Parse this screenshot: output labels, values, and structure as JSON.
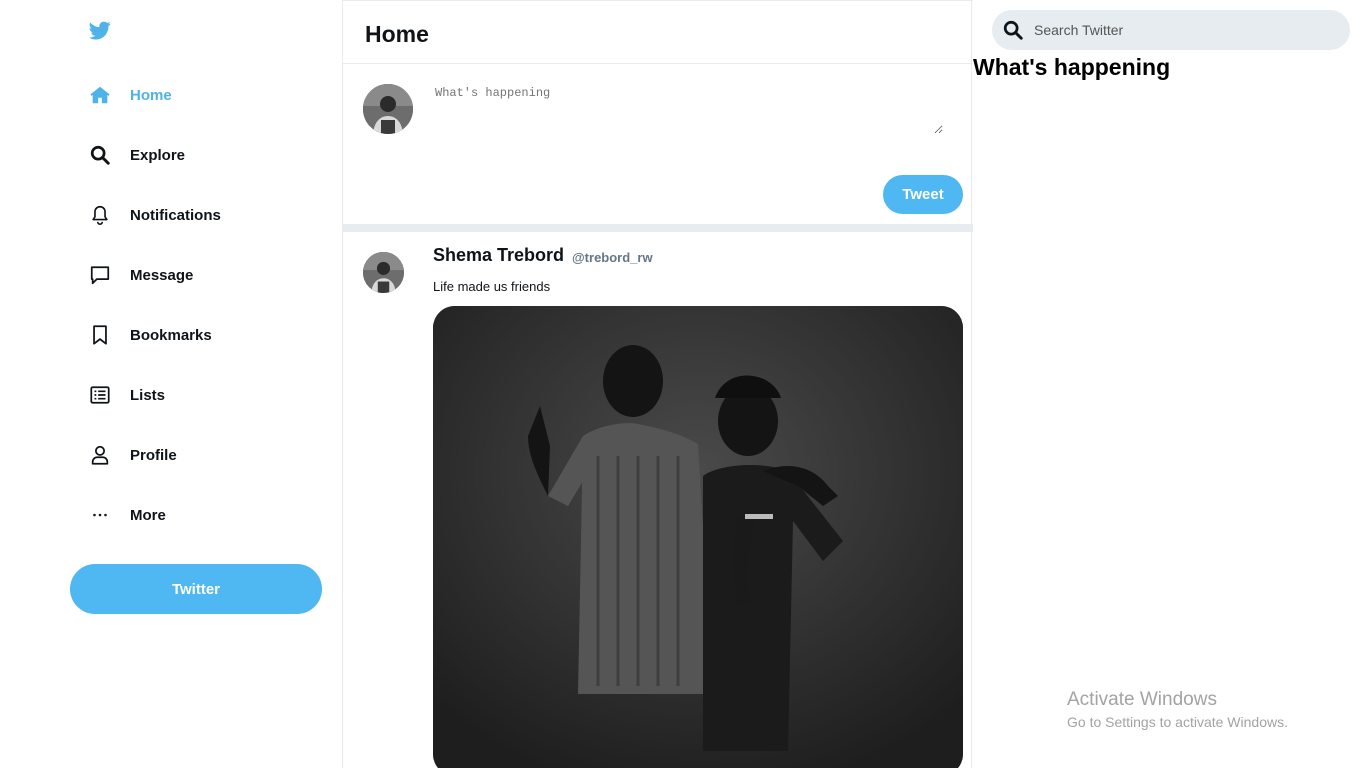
{
  "sidebar": {
    "logo_icon": "twitter-bird-icon",
    "items": [
      {
        "label": "Home",
        "icon": "home-icon",
        "active": true
      },
      {
        "label": "Explore",
        "icon": "search-icon"
      },
      {
        "label": "Notifications",
        "icon": "bell-icon"
      },
      {
        "label": "Message",
        "icon": "message-icon"
      },
      {
        "label": "Bookmarks",
        "icon": "bookmark-icon"
      },
      {
        "label": "Lists",
        "icon": "list-icon"
      },
      {
        "label": "Profile",
        "icon": "profile-icon"
      },
      {
        "label": "More",
        "icon": "more-icon"
      }
    ],
    "tweet_button_label": "Twitter"
  },
  "main": {
    "title": "Home",
    "composer": {
      "placeholder": "What's happening",
      "tweet_button_label": "Tweet"
    },
    "post": {
      "author_name": "Shema Trebord",
      "author_handle": "@trebord_rw",
      "text": "Life made us friends"
    }
  },
  "right": {
    "search_placeholder": "Search Twitter",
    "trends_title": "What's happening"
  },
  "os_watermark": {
    "line1": "Activate Windows",
    "line2": "Go to Settings to activate Windows."
  },
  "colors": {
    "accent": "#4fb7f2",
    "active_nav": "#4fb3ea",
    "divider": "#e6ecf0"
  }
}
